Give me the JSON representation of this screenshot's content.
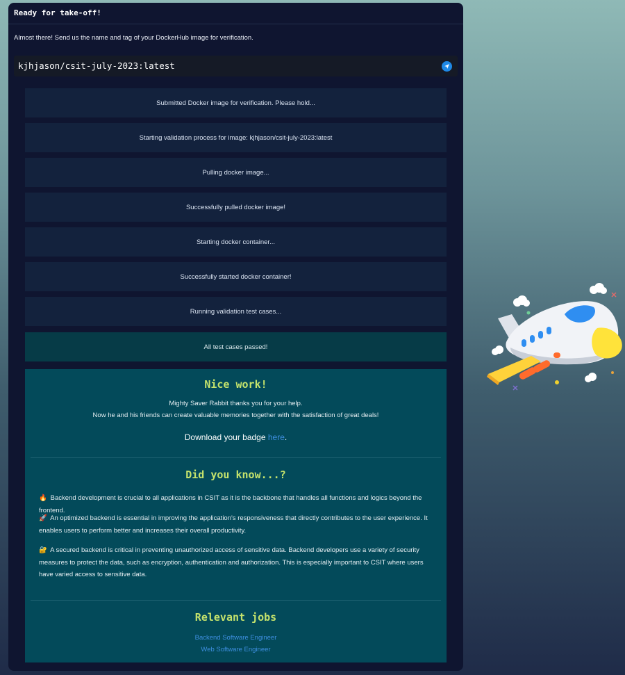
{
  "panel": {
    "title": "Ready for take-off!",
    "prompt": "Almost there! Send us the name and tag of your DockerHub image for verification.",
    "input_value": "kjhjason/csit-july-2023:latest"
  },
  "statuses": [
    "Submitted Docker image for verification. Please hold...",
    "Starting validation process for image: kjhjason/csit-july-2023:latest",
    "Pulling docker image...",
    "Successfully pulled docker image!",
    "Starting docker container...",
    "Successfully started docker container!",
    "Running validation test cases...",
    "All test cases passed!"
  ],
  "result": {
    "heading": "Nice work!",
    "thanks_line1": "Mighty Saver Rabbit thanks you for your help.",
    "thanks_line2": "Now he and his friends can create valuable memories together with the satisfaction of great deals!",
    "download_prefix": "Download your badge ",
    "download_link": "here",
    "download_suffix": ".",
    "dyk_heading": "Did you know...?",
    "facts": [
      {
        "icon": "🔥",
        "text": "Backend development is crucial to all applications in CSIT as it is the backbone that handles all functions and logics beyond the frontend."
      },
      {
        "icon": "🚀",
        "text": "An optimized backend is essential in improving the application's responsiveness that directly contributes to the user experience. It enables users to perform better and increases their overall productivity."
      },
      {
        "icon": "🔐",
        "text": "A secured backend is critical in preventing unauthorized access of sensitive data. Backend developers use a variety of security measures to protect the data, such as encryption, authentication and authorization. This is especially important to CSIT where users have varied access to sensitive data."
      }
    ],
    "jobs_heading": "Relevant jobs",
    "jobs": [
      "Backend Software Engineer",
      "Web Software Engineer"
    ]
  },
  "colors": {
    "panel_bg": "#0f1530",
    "status_bg": "#13223d",
    "success_bg": "#063b47",
    "result_bg": "#034a5a",
    "heading_green": "#c5e36c",
    "link_blue": "#3e8fe0"
  },
  "icons": {
    "send": "send-icon",
    "plane": "airplane-illustration"
  }
}
